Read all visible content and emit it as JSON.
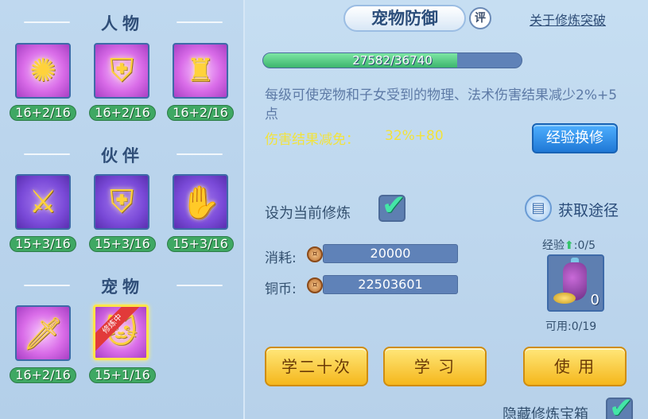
{
  "left": {
    "sections": [
      {
        "title": "人物",
        "slots": [
          {
            "icon": "flame-armor-icon",
            "glyph": "✺",
            "level": "16+2/16"
          },
          {
            "icon": "armor-icon",
            "glyph": "⛨",
            "level": "16+2/16"
          },
          {
            "icon": "body-armor-icon",
            "glyph": "♜",
            "level": "16+2/16"
          }
        ]
      },
      {
        "title": "伙伴",
        "slots": [
          {
            "icon": "sword-beast-icon",
            "glyph": "⚔",
            "level": "15+3/16"
          },
          {
            "icon": "shield-beast-icon",
            "glyph": "⛨",
            "level": "15+3/16"
          },
          {
            "icon": "claw-beast-icon",
            "glyph": "✋",
            "level": "15+3/16"
          }
        ]
      },
      {
        "title": "宠物",
        "slots": [
          {
            "icon": "sword-pet-icon",
            "glyph": "🗡",
            "level": "16+2/16",
            "selected": false
          },
          {
            "icon": "shield-pet-icon",
            "glyph": "🐱",
            "level": "15+1/16",
            "selected": true,
            "ribbon": "修炼中"
          }
        ]
      }
    ]
  },
  "header": {
    "title": "宠物防御",
    "eval_badge": "评",
    "link": "关于修炼突破"
  },
  "progress": {
    "text": "27582/36740",
    "current": 27582,
    "max": 36740
  },
  "description": "每级可使宠物和子女受到的物理、法术伤害结果减少2%+5点",
  "reduction": {
    "label": "伤害结果减免：",
    "value": "32%+80"
  },
  "exchange_button": "经验换修",
  "set_current": {
    "label": "设为当前修炼",
    "checked": true
  },
  "source": {
    "label": "获取途径"
  },
  "cost": {
    "label": "消耗:",
    "value": "20000"
  },
  "copper": {
    "label": "铜币:",
    "value": "22503601"
  },
  "exp_item": {
    "label": "经验",
    "count_text": ":0/5",
    "quantity": "0",
    "available": "可用:0/19"
  },
  "buttons": {
    "learn20": "学二十次",
    "learn": "学 习",
    "use": "使 用"
  },
  "hide_chest": {
    "label": "隐藏修炼宝箱",
    "checked": true
  },
  "colors": {
    "accent_green": "#3fa863",
    "gold": "#f5b71c",
    "reduction_yellow": "#f2e33c"
  }
}
